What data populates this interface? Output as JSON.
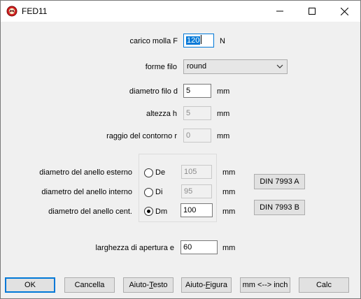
{
  "window": {
    "title": "FED11"
  },
  "fields": {
    "load": {
      "label": "carico molla F",
      "value": "120",
      "unit": "N"
    },
    "wire_shape": {
      "label": "forme filo",
      "value": "round"
    },
    "wire_diameter": {
      "label": "diametro filo d",
      "value": "5",
      "unit": "mm"
    },
    "height": {
      "label": "altezza h",
      "value": "5",
      "unit": "mm"
    },
    "contour_radius": {
      "label": "raggio del contorno r",
      "value": "0",
      "unit": "mm"
    },
    "outer_diameter": {
      "label": "diametro del anello esterno",
      "radio": "De",
      "value": "105",
      "unit": "mm"
    },
    "inner_diameter": {
      "label": "diametro del anello interno",
      "radio": "Di",
      "value": "95",
      "unit": "mm"
    },
    "mean_diameter": {
      "label": "diametro del anello cent.",
      "radio": "Dm",
      "value": "100",
      "unit": "mm",
      "selected": true
    },
    "opening_width": {
      "label": "larghezza di apertura e",
      "value": "60",
      "unit": "mm"
    }
  },
  "side_buttons": {
    "din_a": "DIN 7993 A",
    "din_b": "DIN 7993 B"
  },
  "buttons": {
    "ok": "OK",
    "cancel": "Cancella",
    "help_text_pre": "Aiuto-",
    "help_text_u": "T",
    "help_text_post": "esto",
    "help_fig_pre": "Aiuto-",
    "help_fig_u": "F",
    "help_fig_post": "igura",
    "units": "mm <--> inch",
    "calc": "Calc"
  },
  "icons": {
    "app": "spring-app-icon",
    "minimize": "minimize-icon",
    "maximize": "maximize-icon",
    "close": "close-icon",
    "dropdown": "chevron-down-icon"
  },
  "colors": {
    "accent": "#0078d7",
    "icon_red": "#d21f1f"
  }
}
